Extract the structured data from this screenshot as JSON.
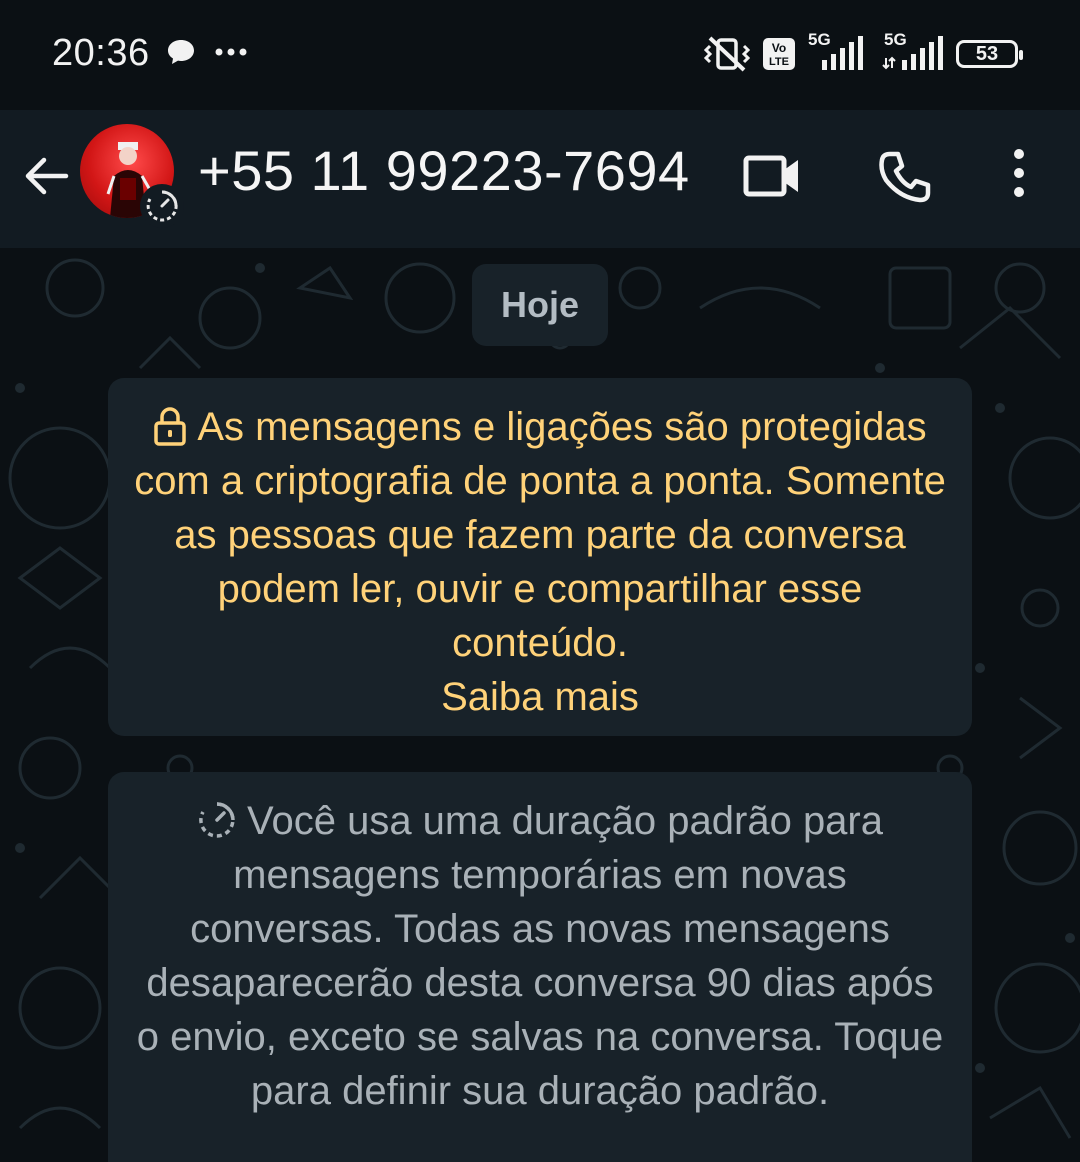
{
  "status_bar": {
    "time": "20:36",
    "volte_label": "Vo\nLTE",
    "network_1": "5G",
    "network_2": "5G",
    "battery_level": "53"
  },
  "header": {
    "contact_name": "+55 11 99223-7694"
  },
  "chat": {
    "date_label": "Hoje",
    "encryption_notice": "As mensagens e ligações são protegidas com a criptografia de ponta a ponta. Somente as pessoas que fazem parte da conversa podem ler, ouvir e compartilhar esse conteúdo.",
    "encryption_link": "Saiba mais",
    "temporary_notice": "Você usa uma duração padrão para mensagens temporárias em novas conversas. Todas as novas mensagens desaparecerão desta conversa 90 dias após o envio, exceto se salvas na conversa. Toque para definir sua duração padrão."
  },
  "colors": {
    "background": "#0b1014",
    "app_bar": "#121b22",
    "bubble": "#182229",
    "encryption_text": "#ffd279",
    "system_text": "#a9b1b7"
  }
}
